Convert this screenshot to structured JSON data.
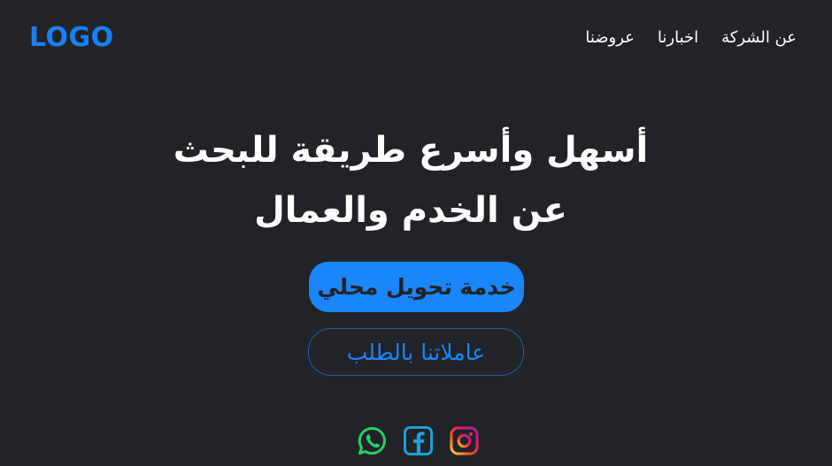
{
  "header": {
    "logo_text": "LOGO",
    "nav": [
      {
        "label": "عن الشركة"
      },
      {
        "label": "اخبارنا"
      },
      {
        "label": "عروضنا"
      }
    ]
  },
  "hero": {
    "headline_line1": "أسهل وأسرع طريقة للبحث",
    "headline_line2": "عن الخدم والعمال",
    "primary_button": "خدمة تحويل محلي",
    "secondary_button": "عاملاتنا بالطلب"
  },
  "socials": [
    {
      "icon": "whatsapp-icon"
    },
    {
      "icon": "facebook-icon"
    },
    {
      "icon": "instagram-icon"
    }
  ],
  "colors": {
    "background": "#212328",
    "accent": "#1a86f8",
    "whatsapp": "#25d366",
    "facebook": "#1aa3e0",
    "text": "#ffffff"
  }
}
